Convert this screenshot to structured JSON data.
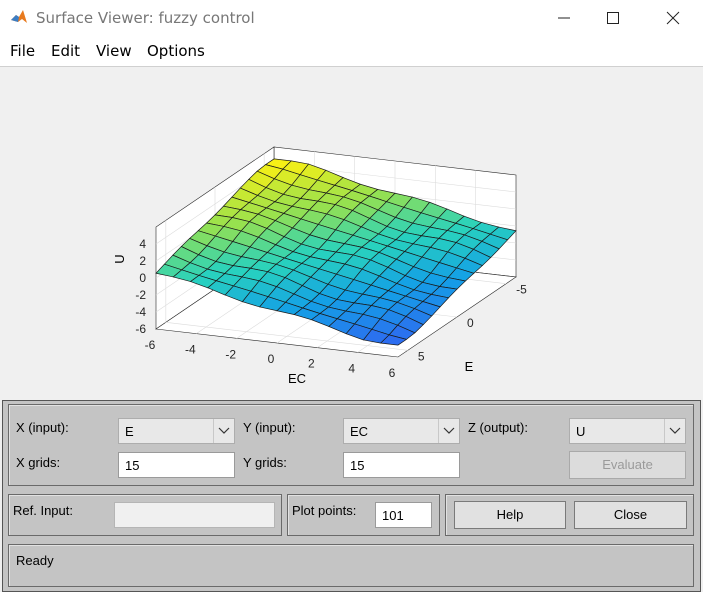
{
  "window": {
    "title": "Surface Viewer: fuzzy control",
    "app_icon": "matlab-icon",
    "controls": {
      "minimize": "minimize-icon",
      "maximize": "maximize-icon",
      "close": "close-icon"
    }
  },
  "menu": [
    "File",
    "Edit",
    "View",
    "Options"
  ],
  "chart_data": {
    "type": "surface",
    "zlabel": "U",
    "xlabel": "EC",
    "ylabel": "E",
    "ec_ticks": [
      "-6",
      "-4",
      "-2",
      "0",
      "2",
      "4",
      "6"
    ],
    "e_ticks": [
      "-5",
      "0",
      "5"
    ],
    "z_ticks": [
      "-6",
      "-4",
      "-2",
      "0",
      "2",
      "4"
    ],
    "ec_range": [
      -6,
      6
    ],
    "e_range": [
      -6,
      6
    ],
    "zlim": [
      -6,
      6
    ],
    "grid": true,
    "colormap": "parula",
    "grid_size": [
      15,
      15
    ]
  },
  "controls": {
    "x_input_label": "X (input):",
    "x_input_value": "E",
    "y_input_label": "Y (input):",
    "y_input_value": "EC",
    "z_output_label": "Z (output):",
    "z_output_value": "U",
    "x_grids_label": "X grids:",
    "x_grids_value": "15",
    "y_grids_label": "Y grids:",
    "y_grids_value": "15",
    "evaluate_label": "Evaluate",
    "ref_input_label": "Ref. Input:",
    "ref_input_value": "",
    "plot_points_label": "Plot points:",
    "plot_points_value": "101",
    "help_label": "Help",
    "close_label": "Close"
  },
  "status": {
    "text": "Ready"
  }
}
